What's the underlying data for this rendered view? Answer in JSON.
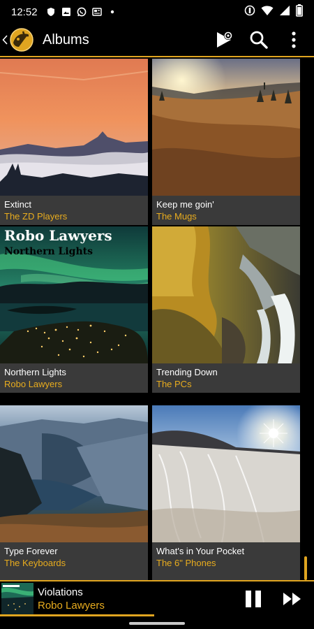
{
  "status_bar": {
    "time": "12:52",
    "left_icons": [
      "shield-icon",
      "image-icon",
      "whatsapp-icon",
      "news-icon",
      "dot-icon"
    ],
    "right_icons": [
      "dnd-icon",
      "wifi-icon",
      "signal-icon",
      "battery-icon"
    ]
  },
  "app_bar": {
    "title": "Albums",
    "actions": [
      "cast-icon",
      "search-icon",
      "more-vert-icon"
    ]
  },
  "albums": [
    {
      "title": "Extinct",
      "artist": "The ZD Players",
      "art": "sunset-mountain-art"
    },
    {
      "title": "Keep me goin'",
      "artist": "The Mugs",
      "art": "autumn-hill-art"
    },
    {
      "title": "Northern Lights",
      "artist": "Robo Lawyers",
      "art": "aurora-art",
      "art_text_1": "Robo Lawyers",
      "art_text_2": "Northern Lights"
    },
    {
      "title": "Trending Down",
      "artist": "The PCs",
      "art": "waterfall-art"
    },
    {
      "title": "Type Forever",
      "artist": "The Keyboards",
      "art": "fjord-art"
    },
    {
      "title": "What's in Your Pocket",
      "artist": "The 6\" Phones",
      "art": "frost-field-art"
    }
  ],
  "now_playing": {
    "title": "Violations",
    "artist": "Robo Lawyers",
    "progress": 0.49
  },
  "colors": {
    "accent": "#e0a520",
    "artist_text": "#e8ac1e",
    "caption_bg": "#3a3a3a"
  }
}
